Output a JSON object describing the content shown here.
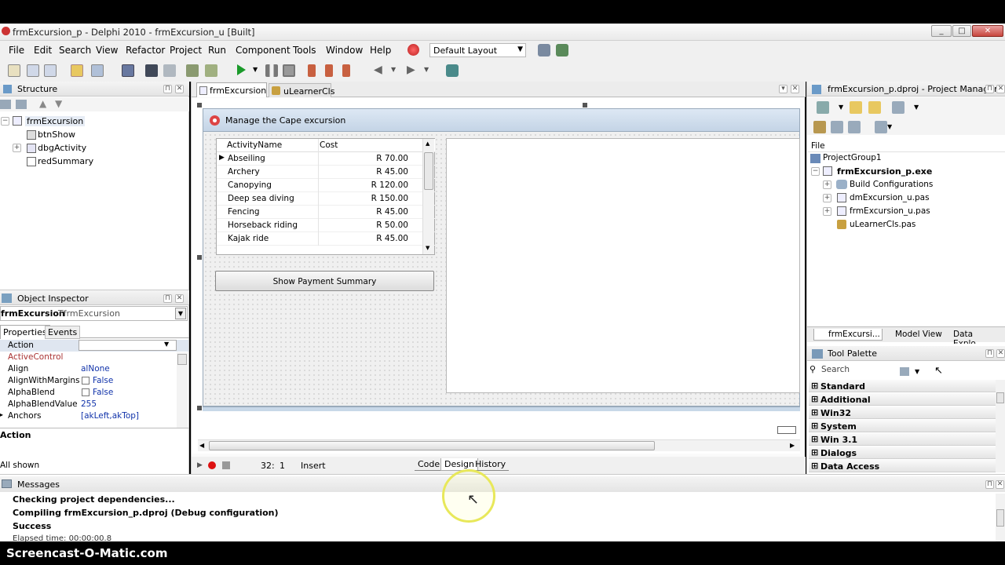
{
  "window": {
    "title": "frmExcursion_p - Delphi 2010 - frmExcursion_u [Built]",
    "minimize": "_",
    "maximize": "□",
    "close": "✕"
  },
  "menu": [
    "File",
    "Edit",
    "Search",
    "View",
    "Refactor",
    "Project",
    "Run",
    "Component",
    "Tools",
    "Window",
    "Help"
  ],
  "layout_select": {
    "value": "Default Layout"
  },
  "structure": {
    "title": "Structure",
    "root": "frmExcursion",
    "children": [
      "btnShow",
      "dbgActivity",
      "redSummary"
    ]
  },
  "object_inspector": {
    "title": "Object Inspector",
    "selected_name": "frmExcursion",
    "selected_type": "TfrmExcursion",
    "tabs": [
      "Properties",
      "Events"
    ],
    "rows": [
      {
        "name": "Action",
        "value": ""
      },
      {
        "name": "ActiveControl",
        "value": ""
      },
      {
        "name": "Align",
        "value": "alNone"
      },
      {
        "name": "AlignWithMargins",
        "value": "False"
      },
      {
        "name": "AlphaBlend",
        "value": "False"
      },
      {
        "name": "AlphaBlendValue",
        "value": "255"
      },
      {
        "name": "Anchors",
        "value": "[akLeft,akTop]"
      }
    ],
    "footer": "Action",
    "status": "All shown"
  },
  "editor": {
    "tabs": [
      "frmExcursion_u",
      "uLearnerCls"
    ],
    "form_caption": "Manage the Cape excursion",
    "grid": {
      "headers": [
        "ActivityName",
        "Cost"
      ],
      "rows": [
        [
          "Abseiling",
          "R 70.00"
        ],
        [
          "Archery",
          "R 45.00"
        ],
        [
          "Canopying",
          "R 120.00"
        ],
        [
          "Deep sea diving",
          "R 150.00"
        ],
        [
          "Fencing",
          "R 45.00"
        ],
        [
          "Horseback riding",
          "R 50.00"
        ],
        [
          "Kajak ride",
          "R 45.00"
        ]
      ]
    },
    "button": "Show Payment Summary",
    "status_line": "32:",
    "status_col": "1",
    "status_mode": "Insert",
    "bottom_tabs": [
      "Code",
      "Design",
      "History"
    ]
  },
  "project_manager": {
    "title": "frmExcursion_p.dproj - Project Manager",
    "column": "File",
    "group": "ProjectGroup1",
    "project": "frmExcursion_p.exe",
    "items": [
      "Build Configurations",
      "dmExcursion_u.pas",
      "frmExcursion_u.pas",
      "uLearnerCls.pas"
    ],
    "tabs": [
      "frmExcursi...",
      "Model View",
      "Data Explo..."
    ]
  },
  "tool_palette": {
    "title": "Tool Palette",
    "search_placeholder": "Search",
    "categories": [
      "Standard",
      "Additional",
      "Win32",
      "System",
      "Win 3.1",
      "Dialogs",
      "Data Access"
    ]
  },
  "messages": {
    "title": "Messages",
    "lines": [
      "Checking project dependencies...",
      "Compiling frmExcursion_p.dproj (Debug configuration)",
      "Success",
      "Elapsed time: 00:00:00.8"
    ]
  },
  "watermark": "Screencast-O-Matic.com",
  "colors": {
    "accent": "#2a6ebb",
    "highlight_ring": "#e8e85a"
  }
}
